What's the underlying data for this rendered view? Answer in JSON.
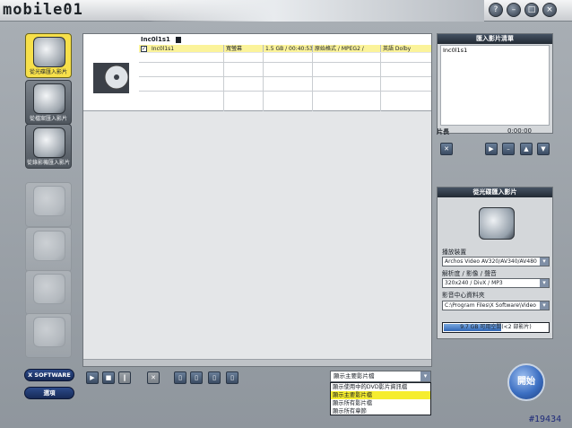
{
  "app": {
    "logo": "mobile01",
    "window_buttons": [
      "?",
      "–",
      "□",
      "×"
    ]
  },
  "sidebar": {
    "items": [
      {
        "label": "從光碟匯入影片",
        "icon": "dvd-disc-icon",
        "state": "active"
      },
      {
        "label": "從檔案匯入影片",
        "icon": "film-file-icon",
        "state": "normal"
      },
      {
        "label": "從錄影機匯入影片",
        "icon": "camcorder-icon",
        "state": "normal"
      },
      {
        "label": "",
        "icon": "disc-burn-icon",
        "state": "disabled"
      },
      {
        "label": "",
        "icon": "photo-icon",
        "state": "disabled"
      },
      {
        "label": "",
        "icon": "edit-icon",
        "state": "disabled"
      },
      {
        "label": "",
        "icon": "settings-film-icon",
        "state": "disabled"
      }
    ],
    "xsoftware_label": "X SOFTWARE",
    "options_label": "選項"
  },
  "disc": {
    "name": "Inc0l1s1",
    "selected_row": {
      "checked": true,
      "title": "Inc0l1s1",
      "aspect": "寬螢幕",
      "size_time": "1.5 GB / 00:40:53",
      "format": "原始格式 / MPEG2 /",
      "audio": "英語 Dolby"
    }
  },
  "toolbar": {
    "buttons": [
      "play-icon",
      "stop-icon",
      "pause-icon",
      "delete-icon",
      "view1-icon",
      "view2-icon",
      "view3-icon",
      "view4-icon"
    ],
    "dropdown_value": "顯示主要影片檔",
    "dropdown_options": [
      "顯示使用中的DVD影片資訊檔",
      "顯示主要影片檔",
      "顯示所有影片檔",
      "顯示所有章節"
    ],
    "dropdown_highlight_index": 1
  },
  "import_panel": {
    "title": "匯入影片清單",
    "items": [
      "Inc0l1s1"
    ],
    "length_label": "片長",
    "length_value": "0:00:00"
  },
  "source_panel": {
    "title": "從光碟匯入影片",
    "device_label": "播放裝置",
    "device_value": "Archos Video AV320/AV340/AV480",
    "resolution_label": "解析度 / 影像 / 聲音",
    "resolution_value": "320x240 / DivX / MP3",
    "folder_label": "影音中心資料夾",
    "folder_value": "C:\\Program Files\\X Software\\Video",
    "space_text": "9.7 GB 可用空間(<2 部影片)",
    "space_fraction": 0.55
  },
  "start_label": "開始",
  "watermark": "#19434"
}
